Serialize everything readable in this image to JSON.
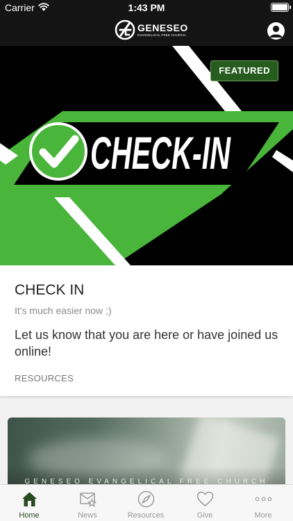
{
  "status_bar": {
    "carrier": "Carrier",
    "time": "1:43 PM"
  },
  "header": {
    "logo_name": "GENESEO",
    "logo_subtitle": "EVANGELICAL FREE CHURCH",
    "profile_icon": "person-icon"
  },
  "featured": {
    "badge": "FEATURED",
    "banner_text": "CHECK-IN",
    "banner_icon": "checkmark-circle-icon",
    "accent_color": "#49b53a",
    "title": "CHECK IN",
    "subtitle": "It's much easier now ;)",
    "body": "Let us know that you are here or have joined us online!",
    "category": "RESOURCES"
  },
  "secondary_card": {
    "text": "GENESEO EVANGELICAL FREE CHURCH"
  },
  "tabs": [
    {
      "label": "Home",
      "icon": "home-icon",
      "active": true
    },
    {
      "label": "News",
      "icon": "news-icon",
      "active": false
    },
    {
      "label": "Resources",
      "icon": "compass-icon",
      "active": false
    },
    {
      "label": "Give",
      "icon": "heart-icon",
      "active": false
    },
    {
      "label": "More",
      "icon": "more-dots-icon",
      "active": false
    }
  ],
  "colors": {
    "bar": "#141414",
    "active_tab": "#2a4a22",
    "inactive_tab": "#9a9a9a"
  }
}
